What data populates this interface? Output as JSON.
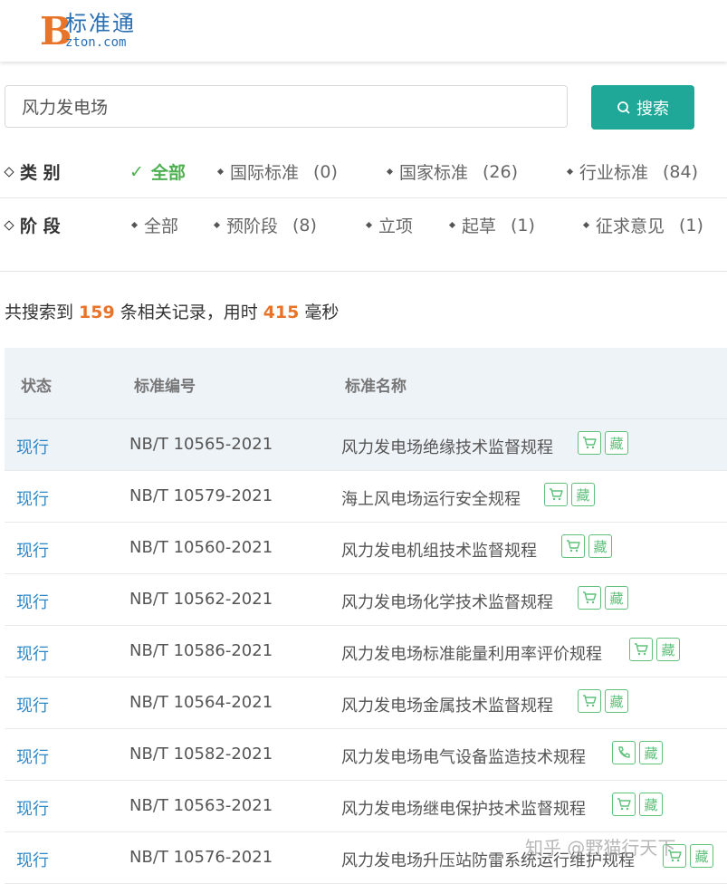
{
  "header": {
    "logo_letter": "B",
    "logo_cn": "标准通",
    "logo_en": "zton.com"
  },
  "search": {
    "value": "风力发电场",
    "button_label": "搜索"
  },
  "filters": {
    "category": {
      "title": "类 别",
      "options": [
        {
          "label": "全部"
        },
        {
          "label": "国际标准",
          "count": "(0)"
        },
        {
          "label": "国家标准",
          "count": "(26)"
        },
        {
          "label": "行业标准",
          "count": "(84)"
        }
      ]
    },
    "stage": {
      "title": "阶 段",
      "options": [
        {
          "label": "全部"
        },
        {
          "label": "预阶段",
          "count": "(8)"
        },
        {
          "label": "立项"
        },
        {
          "label": "起草",
          "count": "(1)"
        },
        {
          "label": "征求意见",
          "count": "(1)"
        }
      ]
    }
  },
  "summary": {
    "prefix": "共搜索到",
    "count": "159",
    "middle": "条相关记录，用时",
    "time": "415",
    "suffix": "毫秒"
  },
  "table": {
    "headers": [
      "状态",
      "标准编号",
      "标准名称"
    ],
    "collect_label": "藏",
    "rows": [
      {
        "status": "现行",
        "code": "NB/T 10565-2021",
        "name": "风力发电场绝缘技术监督规程",
        "icon": "cart-icon"
      },
      {
        "status": "现行",
        "code": "NB/T 10579-2021",
        "name": "海上风电场运行安全规程",
        "icon": "cart-icon"
      },
      {
        "status": "现行",
        "code": "NB/T 10560-2021",
        "name": "风力发电机组技术监督规程",
        "icon": "cart-icon"
      },
      {
        "status": "现行",
        "code": "NB/T 10562-2021",
        "name": "风力发电场化学技术监督规程",
        "icon": "cart-icon"
      },
      {
        "status": "现行",
        "code": "NB/T 10586-2021",
        "name": "风力发电场标准能量利用率评价规程",
        "icon": "cart-icon"
      },
      {
        "status": "现行",
        "code": "NB/T 10564-2021",
        "name": "风力发电场金属技术监督规程",
        "icon": "cart-icon"
      },
      {
        "status": "现行",
        "code": "NB/T 10582-2021",
        "name": "风力发电场电气设备监造技术规程",
        "icon": "phone-icon"
      },
      {
        "status": "现行",
        "code": "NB/T 10563-2021",
        "name": "风力发电场继电保护技术监督规程",
        "icon": "cart-icon"
      },
      {
        "status": "现行",
        "code": "NB/T 10576-2021",
        "name": "风力发电场升压站防雷系统运行维护规程",
        "icon": "cart-icon"
      }
    ]
  },
  "watermark": "知乎 @野猫行天下"
}
